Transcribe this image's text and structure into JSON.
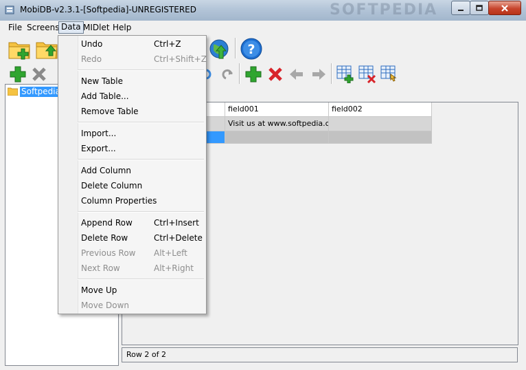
{
  "window": {
    "title": "MobiDB-v2.3.1-[Softpedia]-UNREGISTERED",
    "watermark": "SOFTPEDIA"
  },
  "menubar": {
    "items": [
      {
        "label": "File"
      },
      {
        "label": "Screens"
      },
      {
        "label": "Data"
      },
      {
        "label": "MIDlet"
      },
      {
        "label": "Help"
      }
    ]
  },
  "tree": {
    "root_label": "Softpedia"
  },
  "grid": {
    "columns": [
      "",
      "field001",
      "field002"
    ],
    "rows": [
      [
        "",
        "Visit us at www.softpedia.com",
        ""
      ],
      [
        "",
        "",
        ""
      ]
    ]
  },
  "status": {
    "text": "Row 2 of 2"
  },
  "data_menu": {
    "items": [
      {
        "label": "Undo",
        "shortcut": "Ctrl+Z",
        "disabled": false
      },
      {
        "label": "Redo",
        "shortcut": "Ctrl+Shift+Z",
        "disabled": true
      },
      {
        "label": "New Table",
        "shortcut": "",
        "disabled": false
      },
      {
        "label": "Add Table...",
        "shortcut": "",
        "disabled": false
      },
      {
        "label": "Remove Table",
        "shortcut": "",
        "disabled": false
      },
      {
        "label": "Import...",
        "shortcut": "",
        "disabled": false
      },
      {
        "label": "Export...",
        "shortcut": "",
        "disabled": false
      },
      {
        "label": "Add Column",
        "shortcut": "",
        "disabled": false
      },
      {
        "label": "Delete Column",
        "shortcut": "",
        "disabled": false
      },
      {
        "label": "Column Properties",
        "shortcut": "",
        "disabled": false
      },
      {
        "label": "Append Row",
        "shortcut": "Ctrl+Insert",
        "disabled": false
      },
      {
        "label": "Delete Row",
        "shortcut": "Ctrl+Delete",
        "disabled": false
      },
      {
        "label": "Previous Row",
        "shortcut": "Alt+Left",
        "disabled": true
      },
      {
        "label": "Next Row",
        "shortcut": "Alt+Right",
        "disabled": true
      },
      {
        "label": "Move Up",
        "shortcut": "",
        "disabled": false
      },
      {
        "label": "Move Down",
        "shortcut": "",
        "disabled": true
      }
    ]
  },
  "colors": {
    "selection": "#3399ff",
    "add_green": "#2fa52f",
    "delete_red": "#d8242a",
    "help_blue": "#1e6fd1"
  }
}
